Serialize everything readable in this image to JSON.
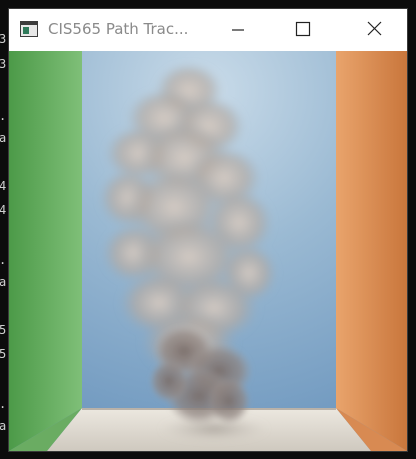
{
  "console": {
    "visible_chars": [
      {
        "char": "3"
      },
      {
        "char": "3"
      },
      {
        "char": "."
      },
      {
        "char": "a"
      },
      {
        "char": "4"
      },
      {
        "char": "4"
      },
      {
        "char": "."
      },
      {
        "char": "a"
      },
      {
        "char": "5"
      },
      {
        "char": "5"
      },
      {
        "char": "."
      },
      {
        "char": "a"
      }
    ]
  },
  "window": {
    "title": "CIS565 Path Trac...",
    "controls": {
      "minimize_icon": "minimize-icon",
      "maximize_icon": "maximize-icon",
      "close_icon": "close-icon"
    }
  },
  "render": {
    "scene": "cornell-box-smoke",
    "colors": {
      "left_wall": "#5aa655",
      "right_wall": "#d9894e",
      "back_wall": "#8fb2cf",
      "floor": "#d8d2c8",
      "smoke": "#b9aea4"
    }
  }
}
